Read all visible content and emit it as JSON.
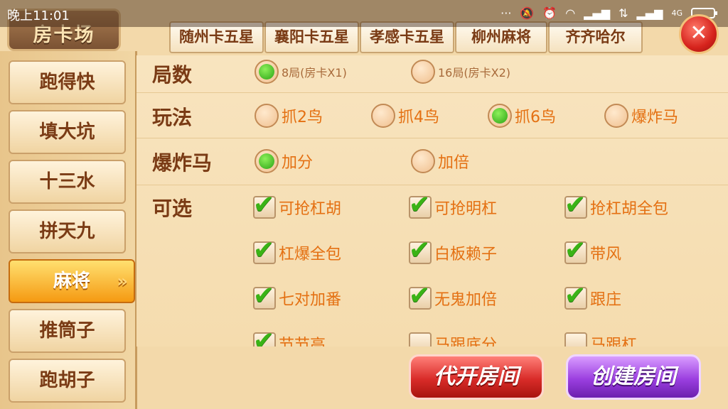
{
  "status_bar": {
    "time": "晚上11:01",
    "network": "4G"
  },
  "page_title": "房卡场",
  "sidebar": {
    "items": [
      {
        "label": "跑得快",
        "active": false
      },
      {
        "label": "填大坑",
        "active": false
      },
      {
        "label": "十三水",
        "active": false
      },
      {
        "label": "拼天九",
        "active": false
      },
      {
        "label": "麻将",
        "active": true
      },
      {
        "label": "推筒子",
        "active": false
      },
      {
        "label": "跑胡子",
        "active": false
      }
    ]
  },
  "tabs": [
    {
      "label": "随州卡五星"
    },
    {
      "label": "襄阳卡五星"
    },
    {
      "label": "孝感卡五星"
    },
    {
      "label": "柳州麻将"
    },
    {
      "label": "齐齐哈尔"
    }
  ],
  "close_symbol": "✕",
  "rows": {
    "rounds": {
      "label": "局数",
      "options": [
        {
          "label": "8局(房卡X1)",
          "selected": true
        },
        {
          "label": "16局(房卡X2)",
          "selected": false
        }
      ]
    },
    "gameplay": {
      "label": "玩法",
      "options": [
        {
          "label": "抓2鸟",
          "selected": false
        },
        {
          "label": "抓4鸟",
          "selected": false
        },
        {
          "label": "抓6鸟",
          "selected": true
        },
        {
          "label": "爆炸马",
          "selected": false
        }
      ]
    },
    "bomb_horse": {
      "label": "爆炸马",
      "options": [
        {
          "label": "加分",
          "selected": true
        },
        {
          "label": "加倍",
          "selected": false
        }
      ]
    },
    "optional": {
      "label": "可选",
      "options": [
        {
          "label": "可抢杠胡",
          "checked": true
        },
        {
          "label": "可抢明杠",
          "checked": true
        },
        {
          "label": "抢杠胡全包",
          "checked": true
        },
        {
          "label": "杠爆全包",
          "checked": true
        },
        {
          "label": "白板赖子",
          "checked": true
        },
        {
          "label": "带风",
          "checked": true
        },
        {
          "label": "七对加番",
          "checked": true
        },
        {
          "label": "无鬼加倍",
          "checked": true
        },
        {
          "label": "跟庄",
          "checked": true
        },
        {
          "label": "节节高",
          "checked": true
        },
        {
          "label": "马跟底分",
          "checked": false
        },
        {
          "label": "马跟杠",
          "checked": false
        }
      ]
    }
  },
  "buttons": {
    "proxy_open": "代开房间",
    "create_room": "创建房间"
  },
  "colors": {
    "accent_orange": "#e47012",
    "label_brown": "#7a3b15",
    "red_button": "#d92c29",
    "purple_button": "#9b3fe0"
  }
}
